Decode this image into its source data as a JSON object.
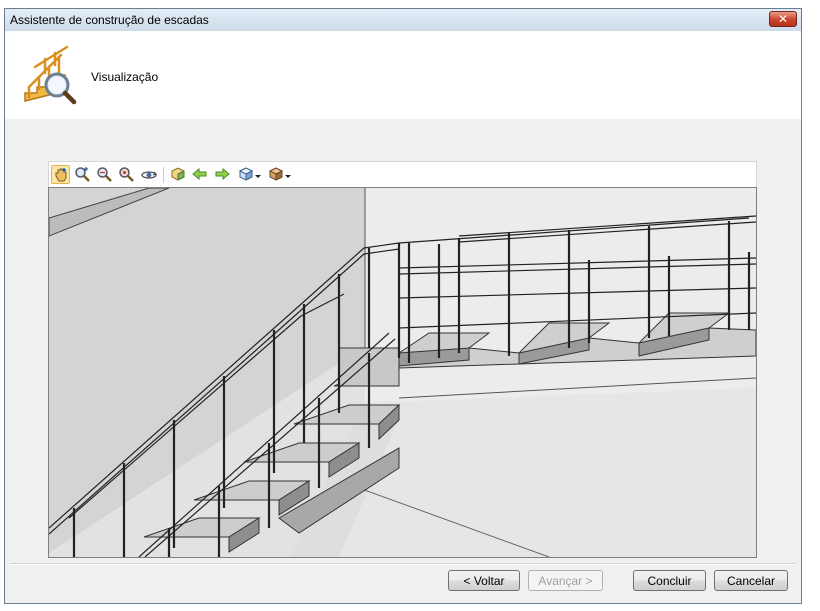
{
  "window": {
    "title": "Assistente de construção de escadas",
    "close_glyph": "✕"
  },
  "header": {
    "step_title": "Visualização",
    "icon": "stair-wizard-magnifier-icon"
  },
  "toolbar": {
    "tools": [
      {
        "name": "pan-tool-icon",
        "active": true
      },
      {
        "name": "zoom-window-icon",
        "active": false
      },
      {
        "name": "zoom-in-out-icon",
        "active": false
      },
      {
        "name": "zoom-extents-icon",
        "active": false
      },
      {
        "name": "orbit-icon",
        "active": false
      },
      {
        "name": "3d-view-icon",
        "active": false
      },
      {
        "name": "rotate-left-icon",
        "active": false
      },
      {
        "name": "rotate-right-icon",
        "active": false
      },
      {
        "name": "view-cube-dropdown-icon",
        "active": false
      },
      {
        "name": "render-style-dropdown-icon",
        "active": false
      }
    ]
  },
  "buttons": {
    "back": "< Voltar",
    "next": "Avançar >",
    "finish": "Concluir",
    "cancel": "Cancelar"
  },
  "colors": {
    "titlebar": "#d6e2ef",
    "window_bg": "#f0f0f0",
    "header_bg": "#ffffff",
    "viewport_bg": "#e2e2e2"
  }
}
